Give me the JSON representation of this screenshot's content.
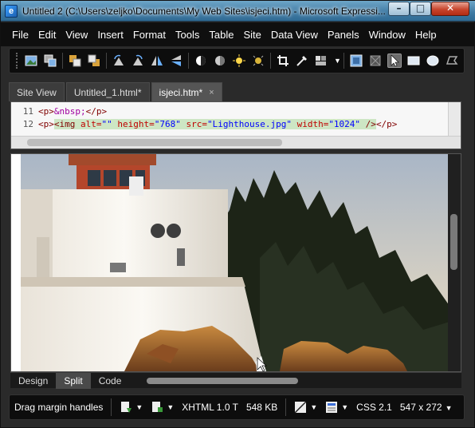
{
  "window": {
    "title": "Untitled 2 (C:\\Users\\zeljko\\Documents\\My Web Sites\\isjeci.htm) - Microsoft Expressi...",
    "minimize": "–",
    "maximize": "□",
    "close": "✕"
  },
  "menu": [
    "File",
    "Edit",
    "View",
    "Insert",
    "Format",
    "Tools",
    "Table",
    "Site",
    "Data View",
    "Panels",
    "Window",
    "Help"
  ],
  "tabs": [
    {
      "label": "Site View"
    },
    {
      "label": "Untitled_1.html*"
    },
    {
      "label": "isjeci.htm*",
      "close": "×"
    }
  ],
  "code": {
    "line1_num": "11",
    "line1_open": "<p>",
    "line1_entity": "&nbsp;",
    "line1_close": "</p>",
    "line2_num": "12",
    "line2_p": "<p>",
    "line2_img": "<img",
    "line2_alt": " alt=",
    "line2_alt_val": "\"\"",
    "line2_height": " height=",
    "line2_height_val": "\"768\"",
    "line2_src": " src=",
    "line2_src_val": "\"Lighthouse.jpg\"",
    "line2_width": " width=",
    "line2_width_val": "\"1024\"",
    "line2_end": " />",
    "line2_pclose": "</p>"
  },
  "views": {
    "design": "Design",
    "split": "Split",
    "code": "Code"
  },
  "status": {
    "hint": "Drag margin handles",
    "doctype": "XHTML 1.0 T",
    "size": "548 KB",
    "css": "CSS 2.1",
    "dimensions": "547 x 272"
  },
  "icons": {
    "caret": "▼"
  }
}
